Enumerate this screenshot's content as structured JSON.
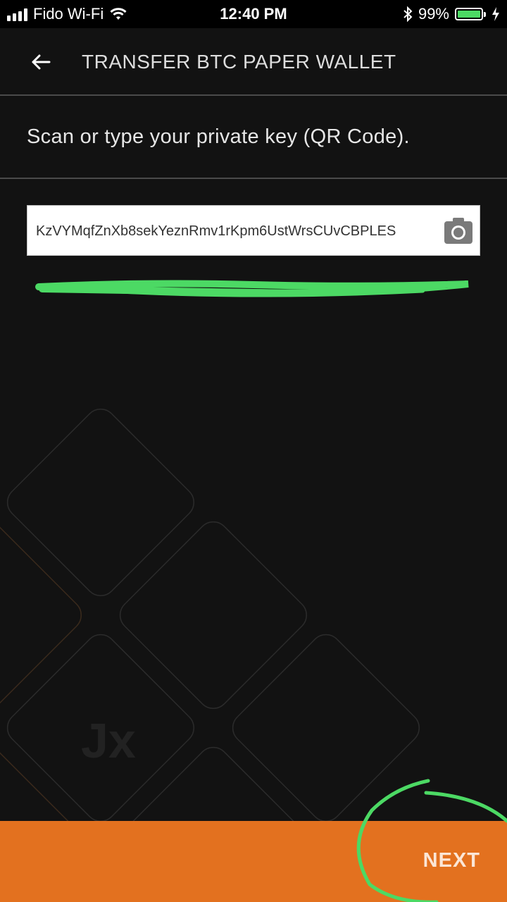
{
  "status_bar": {
    "carrier": "Fido Wi-Fi",
    "time": "12:40 PM",
    "battery": "99%",
    "icons": [
      "signal-icon",
      "wifi-icon",
      "bluetooth-icon",
      "battery-icon",
      "charging-icon"
    ]
  },
  "header": {
    "title": "TRANSFER BTC PAPER WALLET",
    "back_icon": "back-arrow-icon"
  },
  "instruction": "Scan or type your private key (QR Code).",
  "key_input": {
    "value": "KzVYMqfZnXb8sekYeznRmv1rKpm6UstWrsCUvCBPLES",
    "icon": "camera-icon"
  },
  "watermark": "Jx",
  "footer": {
    "next_label": "NEXT"
  },
  "colors": {
    "background": "#121212",
    "accent": "#e3711f",
    "annotation": "#4cd964"
  }
}
